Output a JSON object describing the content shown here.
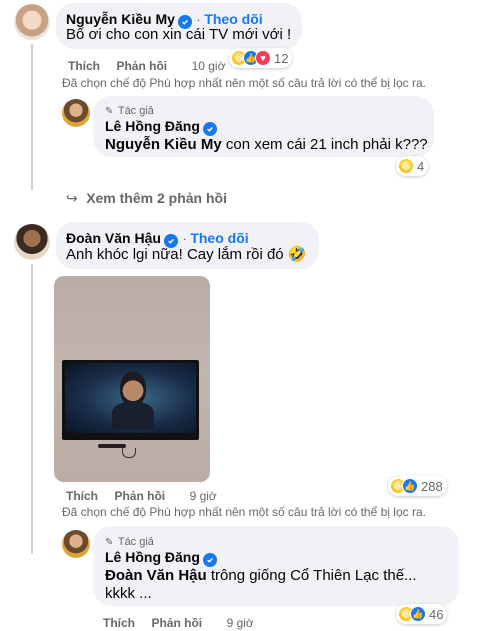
{
  "comment1": {
    "name": "Nguyễn Kiều My",
    "follow": "Theo dõi",
    "text": "Bố ơi cho con xin cái TV mới với !",
    "like": "Thích",
    "reply": "Phản hồi",
    "time": "10 giờ",
    "reaction_count": "12",
    "note": "Đã chọn chế độ Phù hợp nhất nên một số câu trả lời có thể bị lọc ra."
  },
  "reply1": {
    "author_tag": "Tác giả",
    "name": "Lê Hồng Đăng",
    "mention": "Nguyễn Kiều My",
    "text": " con xem cái 21 inch phải k???",
    "reaction_count": "4"
  },
  "more_replies": "Xem thêm 2 phản hồi",
  "comment2": {
    "name": "Đoàn Văn Hậu",
    "follow": "Theo dõi",
    "text": "Anh khóc lgi nữa! Cay lắm rồi đó 🤣",
    "like": "Thích",
    "reply": "Phản hồi",
    "time": "9 giờ",
    "reaction_count": "288",
    "note": "Đã chọn chế độ Phù hợp nhất nên một số câu trả lời có thể bị lọc ra."
  },
  "reply2": {
    "author_tag": "Tác giả",
    "name": "Lê Hồng Đăng",
    "mention": "Đoàn Văn Hậu",
    "text_line1": " trông giống Cổ Thiên Lạc thế...",
    "text_line2": "kkkk ...",
    "like": "Thích",
    "reply": "Phản hồi",
    "time": "9 giờ",
    "reaction_count": "46"
  },
  "colors": {
    "accent": "#1877f2",
    "bubble": "#f0f2f5",
    "meta": "#65676b"
  }
}
